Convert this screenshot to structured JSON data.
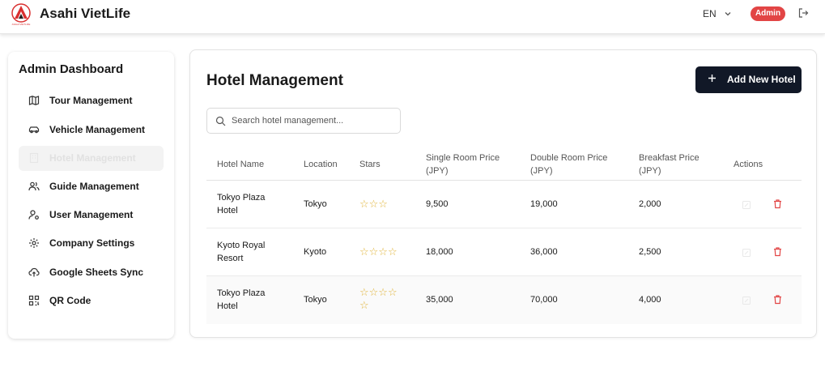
{
  "header": {
    "brand": "Asahi VietLife",
    "logo_text": "ASAHI VIETLIFE",
    "language": "EN",
    "role_badge": "Admin"
  },
  "sidebar": {
    "title": "Admin Dashboard",
    "items": [
      {
        "label": "Tour Management",
        "icon": "map-icon",
        "active": false
      },
      {
        "label": "Vehicle Management",
        "icon": "car-icon",
        "active": false
      },
      {
        "label": "Hotel Management",
        "icon": "building-icon",
        "active": true
      },
      {
        "label": "Guide Management",
        "icon": "users-icon",
        "active": false
      },
      {
        "label": "User Management",
        "icon": "user-cog-icon",
        "active": false
      },
      {
        "label": "Company Settings",
        "icon": "gear-icon",
        "active": false
      },
      {
        "label": "Google Sheets Sync",
        "icon": "cloud-sync-icon",
        "active": false
      },
      {
        "label": "QR Code",
        "icon": "qr-code-icon",
        "active": false
      }
    ]
  },
  "main": {
    "title": "Hotel Management",
    "add_button_label": "Add New Hotel",
    "search_placeholder": "Search hotel management...",
    "table": {
      "headers": {
        "name": "Hotel Name",
        "location": "Location",
        "stars": "Stars",
        "single_1": "Single Room Price",
        "single_2": "(JPY)",
        "double_1": "Double Room Price",
        "double_2": "(JPY)",
        "breakfast_1": "Breakfast Price",
        "breakfast_2": "(JPY)",
        "actions": "Actions"
      },
      "rows": [
        {
          "name_1": "Tokyo Plaza",
          "name_2": "Hotel",
          "location": "Tokyo",
          "stars": 3,
          "stars_line1": "☆☆☆",
          "stars_line2": "",
          "single": "9,500",
          "double": "19,000",
          "breakfast": "2,000"
        },
        {
          "name_1": "Kyoto Royal",
          "name_2": "Resort",
          "location": "Kyoto",
          "stars": 4,
          "stars_line1": "☆☆☆☆",
          "stars_line2": "",
          "single": "18,000",
          "double": "36,000",
          "breakfast": "2,500"
        },
        {
          "name_1": "Tokyo Plaza",
          "name_2": "Hotel",
          "location": "Tokyo",
          "stars": 5,
          "stars_line1": "☆☆☆☆",
          "stars_line2": "☆",
          "single": "35,000",
          "double": "70,000",
          "breakfast": "4,000"
        }
      ]
    }
  },
  "colors": {
    "accent_red": "#e24545",
    "button_dark": "#111827",
    "star": "#e0b43a"
  }
}
